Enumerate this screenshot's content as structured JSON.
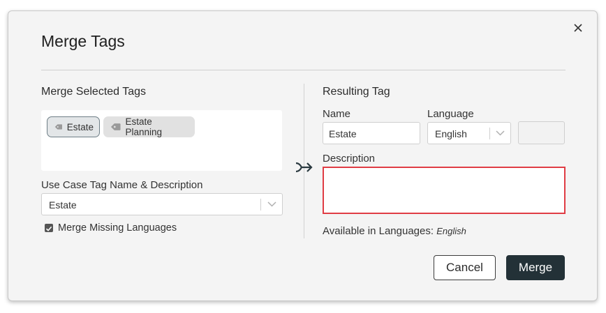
{
  "dialog": {
    "title": "Merge Tags",
    "left": {
      "heading": "Merge Selected Tags",
      "tags": [
        {
          "label": "Estate",
          "selected": true
        },
        {
          "label": "Estate Planning",
          "selected": false
        }
      ],
      "use_case_label": "Use Case Tag Name & Description",
      "use_case_value": "Estate",
      "checkbox_label": "Merge Missing Languages",
      "checkbox_checked": true
    },
    "right": {
      "heading": "Resulting Tag",
      "name_label": "Name",
      "name_value": "Estate",
      "language_label": "Language",
      "language_value": "English",
      "description_label": "Description",
      "description_value": "",
      "available_label": "Available in Languages:",
      "available_value": "English"
    },
    "buttons": {
      "cancel": "Cancel",
      "merge": "Merge"
    }
  },
  "colors": {
    "merge_button": "#233137",
    "description_border": "#e03c44"
  },
  "icons": [
    "close-icon",
    "tag-icon",
    "chevron-down-icon",
    "merge-arrow-icon",
    "check-icon"
  ]
}
